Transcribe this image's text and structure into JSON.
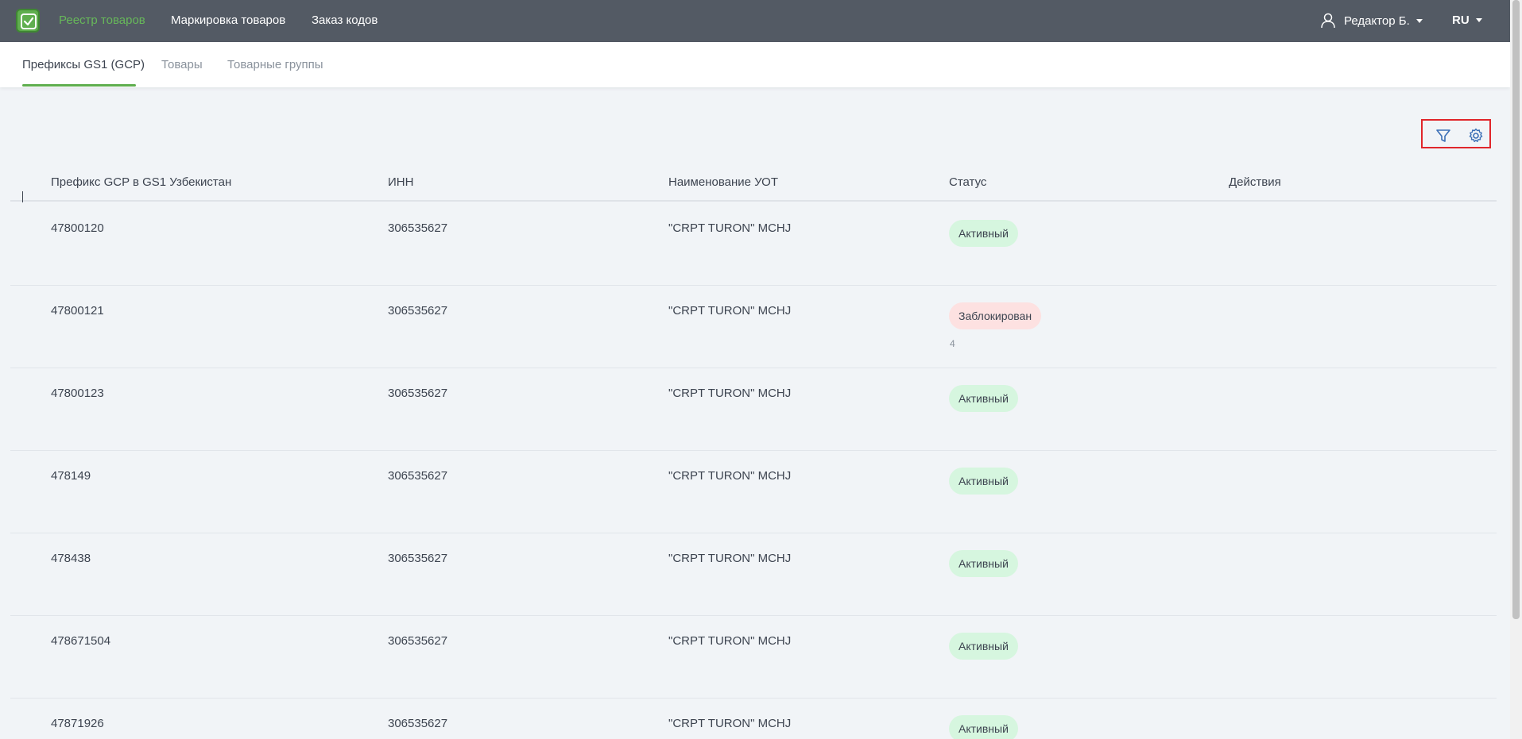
{
  "header": {
    "nav": [
      {
        "label": "Реестр товаров",
        "active": true
      },
      {
        "label": "Маркировка товаров",
        "active": false
      },
      {
        "label": "Заказ кодов",
        "active": false
      }
    ],
    "user_name": "Редактор Б.",
    "language": "RU",
    "colors": {
      "topbar": "#535a64",
      "accent": "#5fae4e"
    }
  },
  "tabs": [
    {
      "label": "Префиксы GS1 (GCP)",
      "active": true
    },
    {
      "label": "Товары",
      "active": false
    },
    {
      "label": "Товарные группы",
      "active": false
    }
  ],
  "toolbar": {
    "icons": [
      "filter-icon",
      "settings-gear-icon"
    ]
  },
  "table": {
    "columns": [
      "Префикс GCP в GS1 Узбекистан",
      "ИНН",
      "Наименование УОТ",
      "Статус",
      "Действия"
    ],
    "rows": [
      {
        "prefix": "47800120",
        "inn": "306535627",
        "name": "\"CRPT TURON\" MCHJ",
        "status": "Активный",
        "status_type": "active",
        "note": ""
      },
      {
        "prefix": "47800121",
        "inn": "306535627",
        "name": "\"CRPT TURON\" MCHJ",
        "status": "Заблокирован",
        "status_type": "blocked",
        "note": "4"
      },
      {
        "prefix": "47800123",
        "inn": "306535627",
        "name": "\"CRPT TURON\" MCHJ",
        "status": "Активный",
        "status_type": "active",
        "note": ""
      },
      {
        "prefix": "478149",
        "inn": "306535627",
        "name": "\"CRPT TURON\" MCHJ",
        "status": "Активный",
        "status_type": "active",
        "note": ""
      },
      {
        "prefix": "478438",
        "inn": "306535627",
        "name": "\"CRPT TURON\" MCHJ",
        "status": "Активный",
        "status_type": "active",
        "note": ""
      },
      {
        "prefix": "478671504",
        "inn": "306535627",
        "name": "\"CRPT TURON\" MCHJ",
        "status": "Активный",
        "status_type": "active",
        "note": ""
      },
      {
        "prefix": "47871926",
        "inn": "306535627",
        "name": "\"CRPT TURON\" MCHJ",
        "status": "Активный",
        "status_type": "active",
        "note": ""
      }
    ],
    "status_colors": {
      "active": "#d6f6df",
      "blocked": "#fde1e1"
    }
  }
}
